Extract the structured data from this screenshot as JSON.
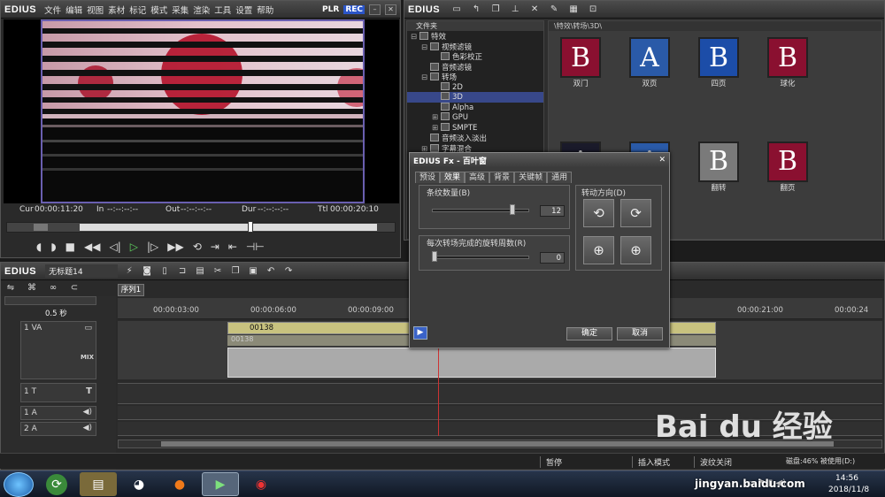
{
  "player": {
    "brand": "EDIUS",
    "menus": [
      "文件",
      "编辑",
      "视图",
      "素材",
      "标记",
      "模式",
      "采集",
      "渲染",
      "工具",
      "设置",
      "帮助"
    ],
    "plr": "PLR",
    "rec": "REC",
    "cur_label": "Cur",
    "cur": "00:00:11:20",
    "in_label": "In",
    "in": "--:--:--:--",
    "out_label": "Out",
    "out": "--:--:--:--",
    "dur_label": "Dur",
    "dur": "--:--:--:--",
    "ttl_label": "Ttl",
    "ttl": "00:00:20:10"
  },
  "bin": {
    "brand": "EDIUS",
    "tree_header": "文件夹",
    "tree": [
      {
        "label": "特效",
        "indent": 0,
        "expander": "⊟"
      },
      {
        "label": "视频滤镜",
        "indent": 1,
        "expander": "⊟"
      },
      {
        "label": "色彩校正",
        "indent": 2,
        "expander": ""
      },
      {
        "label": "音频滤镜",
        "indent": 1,
        "expander": ""
      },
      {
        "label": "转场",
        "indent": 1,
        "expander": "⊟"
      },
      {
        "label": "2D",
        "indent": 2,
        "expander": ""
      },
      {
        "label": "3D",
        "indent": 2,
        "expander": "",
        "selected": true
      },
      {
        "label": "Alpha",
        "indent": 2,
        "expander": ""
      },
      {
        "label": "GPU",
        "indent": 2,
        "expander": "⊞"
      },
      {
        "label": "SMPTE",
        "indent": 2,
        "expander": "⊞"
      },
      {
        "label": "音频淡入淡出",
        "indent": 1,
        "expander": ""
      },
      {
        "label": "字幕混合",
        "indent": 1,
        "expander": "⊞"
      }
    ],
    "path": "\\特效\\转场\\3D\\",
    "thumbs": [
      {
        "label": "双门",
        "glyph": "B"
      },
      {
        "label": "双页",
        "glyph": "A"
      },
      {
        "label": "四页",
        "glyph": "B"
      },
      {
        "label": "球化",
        "glyph": "B"
      },
      {
        "label": "",
        "glyph": "A"
      },
      {
        "label": "",
        "glyph": "A"
      },
      {
        "label": "翻转",
        "glyph": "B"
      },
      {
        "label": "翻页",
        "glyph": "B"
      }
    ]
  },
  "timeline": {
    "brand": "EDIUS",
    "project": "无标题14",
    "sequence_tab": "序列1",
    "zoom": "0.5 秒",
    "ruler": [
      "00:00:03:00",
      "00:00:06:00",
      "00:00:09:00",
      "00:00:21:00",
      "00:00:24"
    ],
    "tracks": [
      {
        "name": "1 VA",
        "kind": "va"
      },
      {
        "name": "1 T",
        "kind": "t"
      },
      {
        "name": "1 A",
        "kind": "a"
      },
      {
        "name": "2 A",
        "kind": "a"
      }
    ],
    "mix_label": "MIX",
    "clip_name": "00138",
    "clip_name2": "00138"
  },
  "dialog": {
    "title": "EDIUS Fx - 百叶窗",
    "close": "✕",
    "tabs": [
      "预设",
      "效果",
      "高级",
      "背景",
      "关键帧",
      "通用"
    ],
    "active_tab": 1,
    "stripes_label": "条纹数量(B)",
    "stripes_value": "12",
    "stripes_level": 0.83,
    "rotations_label": "每次转场完成的旋转周数(R)",
    "rotations_value": "0",
    "rotations_level": 0.0,
    "direction_label": "转动方向(D)",
    "ok": "确定",
    "cancel": "取消"
  },
  "status": {
    "pause": "暂停",
    "insert_mode": "插入模式",
    "ripple_off": "波纹关闭",
    "disk": "磁盘:46% 被使用(D:)"
  },
  "taskbar": {
    "time": "14:56",
    "date": "2018/11/8"
  },
  "watermark": {
    "logo": "Bai du 经验",
    "url": "jingyan.baidu.com"
  }
}
